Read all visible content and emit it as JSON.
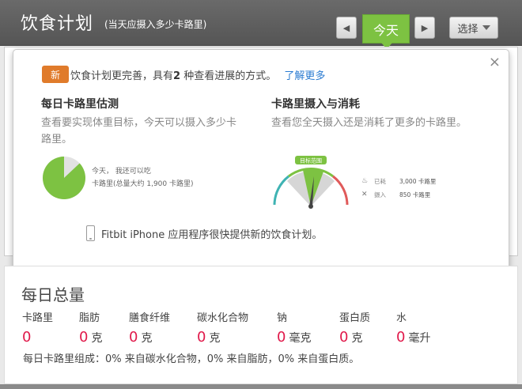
{
  "header": {
    "title": "饮食计划",
    "subtitle": "(当天应摄入多少卡路里)",
    "prev_icon": "chevron-left-icon",
    "next_icon": "chevron-right-icon",
    "today_label": "今天",
    "select_label": "选择",
    "accent": "#7dc242"
  },
  "popup": {
    "close_label": "×",
    "new_badge": "新",
    "intro_before": "饮食计划更完善，具有",
    "intro_count": "2",
    "intro_after": " 种查看进展的方式。",
    "learn_more": "了解更多",
    "left": {
      "title": "每日卡路里估测",
      "desc": "查看要实现体重目标，今天可以摄入多少卡路里。",
      "pie_fraction_filled": 0.87,
      "legend_line1": "今天，  我还可以吃",
      "legend_line2": "卡路里(总量大约 1,900 卡路里)"
    },
    "right": {
      "title": "卡路里摄入与消耗",
      "desc": "查看您全天摄入还是消耗了更多的卡路里。",
      "gauge_label": "目标范围",
      "stats": [
        {
          "icon": "flame-icon",
          "label": "已耗",
          "value": "3,000 卡路里"
        },
        {
          "icon": "fork-knife-icon",
          "label": "摄入",
          "value": "850 卡路里"
        }
      ]
    },
    "phone_text": "Fitbit iPhone 应用程序很快提供新的饮食计划。"
  },
  "totals": {
    "title": "每日总量",
    "nutrients": [
      {
        "label": "卡路里",
        "value": "0",
        "unit": ""
      },
      {
        "label": "脂肪",
        "value": "0",
        "unit": "克"
      },
      {
        "label": "膳食纤维",
        "value": "0",
        "unit": "克"
      },
      {
        "label": "碳水化合物",
        "value": "0",
        "unit": "克"
      },
      {
        "label": "钠",
        "value": "0",
        "unit": "毫克"
      },
      {
        "label": "蛋白质",
        "value": "0",
        "unit": "克"
      },
      {
        "label": "水",
        "value": "0",
        "unit": "毫升"
      }
    ],
    "breakdown": "每日卡路里组成：0% 来自碳水化合物，0% 来自脂肪，0% 来自蛋白质。",
    "value_color": "#e0194a"
  }
}
